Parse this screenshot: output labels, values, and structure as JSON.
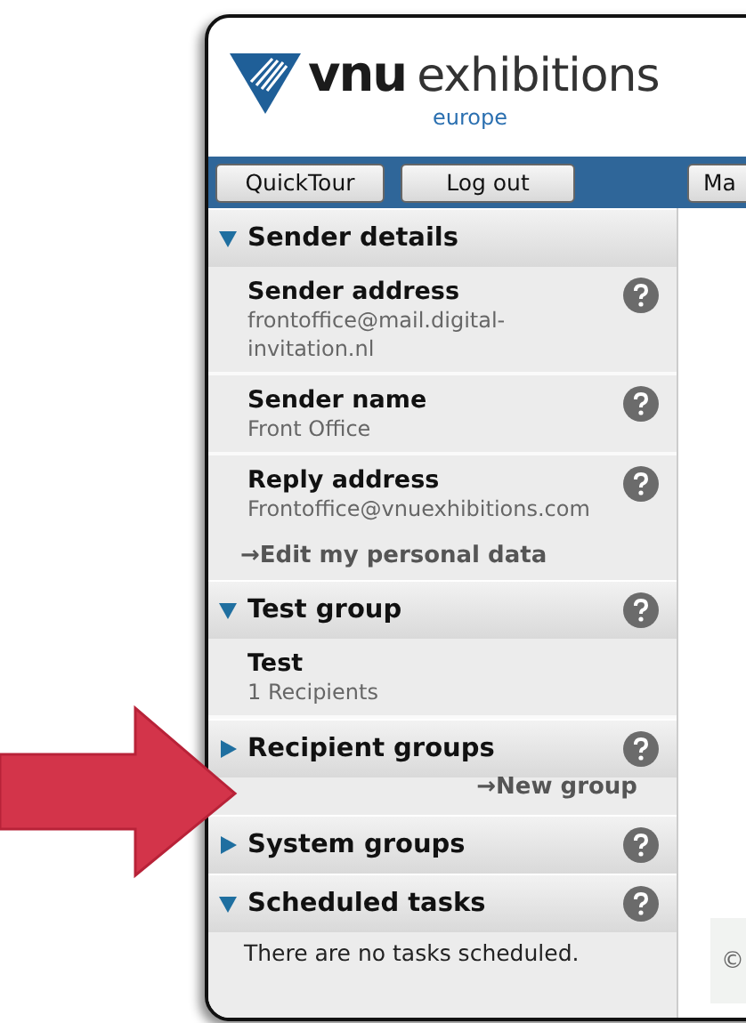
{
  "logo": {
    "brand": "vnu",
    "name": "exhibitions",
    "region": "europe"
  },
  "toolbar": {
    "buttons": [
      "QuickTour",
      "Log out",
      "Ma"
    ]
  },
  "sidebar": {
    "sections": [
      {
        "title": "Sender details",
        "expanded": true,
        "help": false,
        "items": [
          {
            "label": "Sender address",
            "value": "frontoffice@mail.digital-invitation.nl",
            "help": true
          },
          {
            "label": "Sender name",
            "value": "Front Office",
            "help": true
          },
          {
            "label": "Reply address",
            "value": "Frontoffice@vnuexhibitions.com",
            "help": true
          }
        ],
        "link": "→Edit my personal data"
      },
      {
        "title": "Test group",
        "expanded": true,
        "help": true,
        "items": [
          {
            "label": "Test",
            "value": "1 Recipients",
            "help": false
          }
        ]
      },
      {
        "title": "Recipient groups",
        "expanded": false,
        "help": true,
        "link": "→New group"
      },
      {
        "title": "System groups",
        "expanded": false,
        "help": true
      },
      {
        "title": "Scheduled tasks",
        "expanded": true,
        "help": true,
        "note": "There are no tasks scheduled."
      }
    ]
  },
  "footer": {
    "text": "©"
  }
}
